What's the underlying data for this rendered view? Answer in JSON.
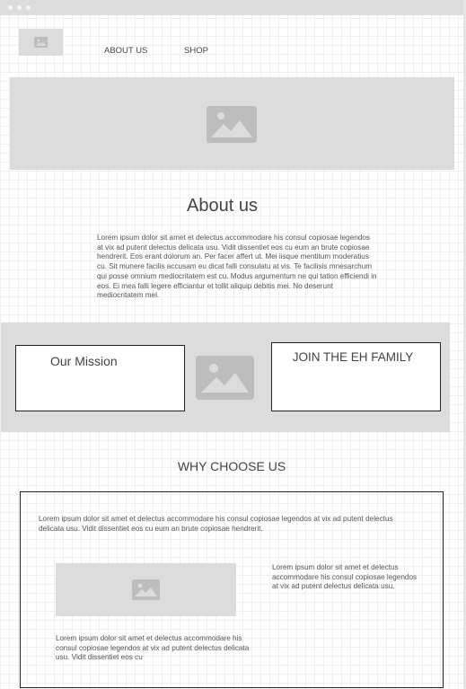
{
  "nav": {
    "about_label": "ABOUT US",
    "shop_label": "SHOP"
  },
  "icons": {
    "logo": "image-placeholder-icon",
    "hero": "image-placeholder-icon",
    "band": "image-placeholder-icon",
    "why": "image-placeholder-icon"
  },
  "colors": {
    "placeholder_gray": "#dcdcdc",
    "icon_gray": "#bdbdbd",
    "border": "#222222"
  },
  "about": {
    "title": "About us",
    "body": "Lorem ipsum dolor sit amet et delectus accommodare his consul copiosae legendos at vix ad putent delectus delicata usu. Vidit dissentiet eos cu eum an brute copiosae hendrerit. Eos erant dolorum an. Per facer affert ut. Mei iisque mentitum moderatius cu. Sit munere facilis accusam eu dicat falli consulatu at vis. Te facilisis mnesarchum qui posse omnium mediocritatem est cu. Modus argumentum ne qui tation efficiendi in eos. Ei mea falli legere efficiantur et tollit aliquip debitis mei. No deserunt mediocritatem mel."
  },
  "band": {
    "mission_title": "Our Mission",
    "join_title": "JOIN THE EH FAMILY"
  },
  "why": {
    "title": "WHY CHOOSE US",
    "intro": "Lorem ipsum dolor sit amet et delectus accommodare his consul copiosae legendos at vix ad putent delectus delicata usu. Vidit dissentiet eos cu eum an brute copiosae hendrerit.",
    "right_text": "Lorem ipsum dolor sit amet et delectus accommodare his consul copiosae legendos at vix ad putent delectus delicata usu.",
    "bottom_text": "Lorem ipsum dolor sit amet et delectus accommodare his consul copiosae legendos at vix ad putent delectus delicata usu. Vidit dissentiet eos cu"
  }
}
